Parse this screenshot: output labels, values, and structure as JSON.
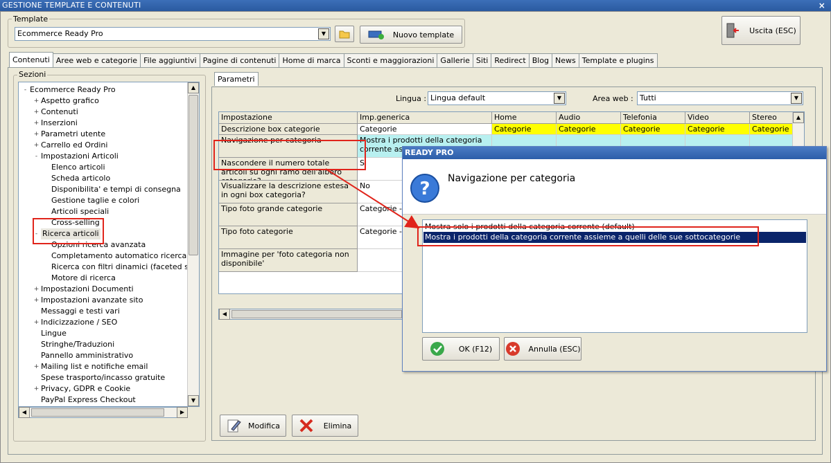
{
  "window": {
    "title": "GESTIONE TEMPLATE E CONTENUTI",
    "close": "×"
  },
  "template": {
    "group_label": "Template",
    "selected": "Ecommerce Ready Pro",
    "new_button": "Nuovo template"
  },
  "exit_button": "Uscita (ESC)",
  "tabs": [
    "Contenuti",
    "Aree web e categorie",
    "File aggiuntivi",
    "Pagine di contenuti",
    "Home di marca",
    "Sconti e maggiorazioni",
    "Gallerie",
    "Siti",
    "Redirect",
    "Blog",
    "News",
    "Template e plugins"
  ],
  "sections": {
    "label": "Sezioni",
    "tree": [
      {
        "label": "Ecommerce Ready Pro",
        "level": 0,
        "exp": "-"
      },
      {
        "label": "Aspetto grafico",
        "level": 1,
        "exp": "+"
      },
      {
        "label": "Contenuti",
        "level": 1,
        "exp": "+"
      },
      {
        "label": "Inserzioni",
        "level": 1,
        "exp": "+"
      },
      {
        "label": "Parametri utente",
        "level": 1,
        "exp": "+"
      },
      {
        "label": "Carrello ed Ordini",
        "level": 1,
        "exp": "+"
      },
      {
        "label": "Impostazioni Articoli",
        "level": 1,
        "exp": "-"
      },
      {
        "label": "Elenco articoli",
        "level": 2,
        "exp": ""
      },
      {
        "label": "Scheda articolo",
        "level": 2,
        "exp": ""
      },
      {
        "label": "Disponibilita' e tempi di consegna",
        "level": 2,
        "exp": ""
      },
      {
        "label": "Gestione taglie e colori",
        "level": 2,
        "exp": ""
      },
      {
        "label": "Articoli speciali",
        "level": 2,
        "exp": ""
      },
      {
        "label": "Cross-selling",
        "level": 2,
        "exp": ""
      },
      {
        "label": "Ricerca articoli",
        "level": 1,
        "exp": "-"
      },
      {
        "label": "Opzioni ricerca avanzata",
        "level": 2,
        "exp": ""
      },
      {
        "label": "Completamento automatico ricerca",
        "level": 2,
        "exp": ""
      },
      {
        "label": "Ricerca con filtri dinamici (faceted search)",
        "level": 2,
        "exp": ""
      },
      {
        "label": "Motore di ricerca",
        "level": 2,
        "exp": ""
      },
      {
        "label": "Impostazioni Documenti",
        "level": 1,
        "exp": "+"
      },
      {
        "label": "Impostazioni avanzate sito",
        "level": 1,
        "exp": "+"
      },
      {
        "label": "Messaggi e testi vari",
        "level": 1,
        "exp": ""
      },
      {
        "label": "Indicizzazione / SEO",
        "level": 1,
        "exp": "+"
      },
      {
        "label": "Lingue",
        "level": 1,
        "exp": ""
      },
      {
        "label": "Stringhe/Traduzioni",
        "level": 1,
        "exp": ""
      },
      {
        "label": "Pannello amministrativo",
        "level": 1,
        "exp": ""
      },
      {
        "label": "Mailing list e notifiche email",
        "level": 1,
        "exp": "+"
      },
      {
        "label": "Spese trasporto/incasso gratuite",
        "level": 1,
        "exp": ""
      },
      {
        "label": "Privacy, GDPR e Cookie",
        "level": 1,
        "exp": "+"
      },
      {
        "label": "PayPal Express Checkout",
        "level": 1,
        "exp": ""
      }
    ]
  },
  "params": {
    "tab": "Parametri",
    "lingua_label": "Lingua :",
    "lingua_value": "Lingua default",
    "area_label": "Area web :",
    "area_value": "Tutti",
    "columns": [
      "Impostazione",
      "Imp.generica",
      "Home",
      "Audio",
      "Telefonia",
      "Video",
      "Stereo"
    ],
    "rows": [
      {
        "name": "Descrizione box categorie",
        "generic": "Categorie",
        "cells": [
          "Categorie",
          "Categorie",
          "Categorie",
          "Categorie",
          "Categorie"
        ],
        "style": "yellow"
      },
      {
        "name": "Navigazione per categoria",
        "generic": "Mostra i prodotti della categoria corrente assieme",
        "cells": [
          "",
          "",
          "",
          "",
          ""
        ],
        "style": "cyan"
      },
      {
        "name": "Nascondere il numero totale articoli su ogni ramo dell'albero categorie?",
        "generic": "Si",
        "cells": [],
        "style": ""
      },
      {
        "name": "Visualizzare la descrizione estesa in ogni box categoria?",
        "generic": "No",
        "cells": [],
        "style": ""
      },
      {
        "name": "Tipo foto grande categorie",
        "generic": "Categorie - g",
        "cells": [],
        "style": ""
      },
      {
        "name": "Tipo foto categorie",
        "generic": "Categorie - g",
        "cells": [],
        "style": ""
      },
      {
        "name": "Immagine per 'foto categoria non disponibile'",
        "generic": "",
        "cells": [],
        "style": ""
      }
    ],
    "modify_button": "Modifica",
    "delete_button": "Elimina"
  },
  "dialog": {
    "title": "READY PRO",
    "heading": "Navigazione per categoria",
    "options": [
      "Mostra solo i prodotti della categoria corrente (default)",
      "Mostra i prodotti della categoria corrente assieme a quelli delle sue sottocategorie"
    ],
    "selected_index": 1,
    "ok_button": "OK (F12)",
    "cancel_button": "Annulla (ESC)"
  },
  "colors": {
    "title_bar": "#2a5aa0",
    "highlight_yellow": "#ffff00",
    "highlight_cyan": "#b8f0f0",
    "selection": "#0a246a",
    "annotation_red": "#e0241b"
  }
}
